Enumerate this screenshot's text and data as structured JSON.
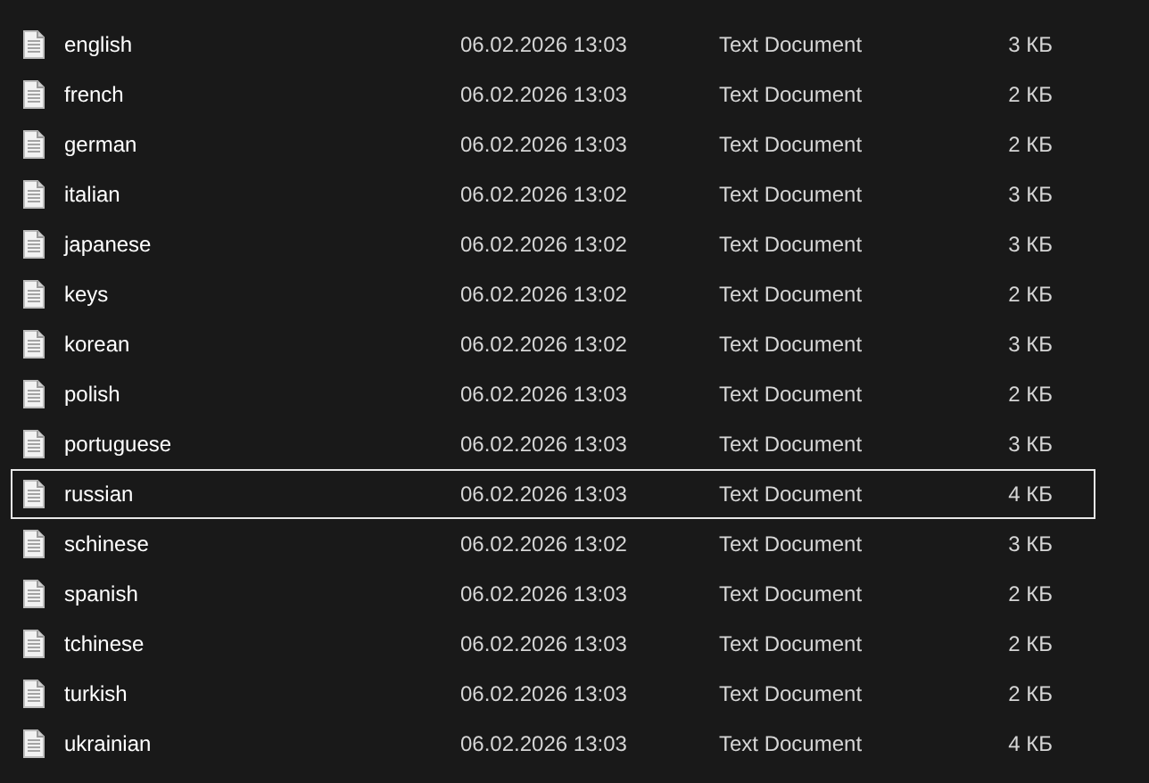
{
  "files": [
    {
      "name": "english",
      "date": "06.02.2026 13:03",
      "type": "Text Document",
      "size": "3 КБ",
      "focused": false
    },
    {
      "name": "french",
      "date": "06.02.2026 13:03",
      "type": "Text Document",
      "size": "2 КБ",
      "focused": false
    },
    {
      "name": "german",
      "date": "06.02.2026 13:03",
      "type": "Text Document",
      "size": "2 КБ",
      "focused": false
    },
    {
      "name": "italian",
      "date": "06.02.2026 13:02",
      "type": "Text Document",
      "size": "3 КБ",
      "focused": false
    },
    {
      "name": "japanese",
      "date": "06.02.2026 13:02",
      "type": "Text Document",
      "size": "3 КБ",
      "focused": false
    },
    {
      "name": "keys",
      "date": "06.02.2026 13:02",
      "type": "Text Document",
      "size": "2 КБ",
      "focused": false
    },
    {
      "name": "korean",
      "date": "06.02.2026 13:02",
      "type": "Text Document",
      "size": "3 КБ",
      "focused": false
    },
    {
      "name": "polish",
      "date": "06.02.2026 13:03",
      "type": "Text Document",
      "size": "2 КБ",
      "focused": false
    },
    {
      "name": "portuguese",
      "date": "06.02.2026 13:03",
      "type": "Text Document",
      "size": "3 КБ",
      "focused": false
    },
    {
      "name": "russian",
      "date": "06.02.2026 13:03",
      "type": "Text Document",
      "size": "4 КБ",
      "focused": true
    },
    {
      "name": "schinese",
      "date": "06.02.2026 13:02",
      "type": "Text Document",
      "size": "3 КБ",
      "focused": false
    },
    {
      "name": "spanish",
      "date": "06.02.2026 13:03",
      "type": "Text Document",
      "size": "2 КБ",
      "focused": false
    },
    {
      "name": "tchinese",
      "date": "06.02.2026 13:03",
      "type": "Text Document",
      "size": "2 КБ",
      "focused": false
    },
    {
      "name": "turkish",
      "date": "06.02.2026 13:03",
      "type": "Text Document",
      "size": "2 КБ",
      "focused": false
    },
    {
      "name": "ukrainian",
      "date": "06.02.2026 13:03",
      "type": "Text Document",
      "size": "4 КБ",
      "focused": false
    }
  ]
}
